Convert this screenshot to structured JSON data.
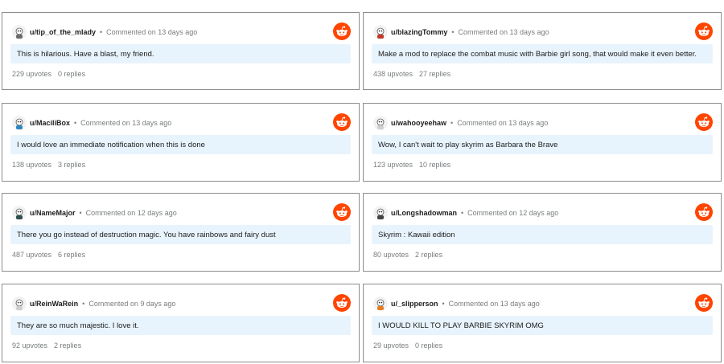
{
  "comments": [
    {
      "user": "u/tip_of_the_mlady",
      "meta": "Commented on 13 days ago",
      "text": "This is hilarious. Have a blast, my friend.",
      "upvotes": "229 upvotes",
      "replies": "0 replies",
      "avatar": "#6b6b6b"
    },
    {
      "user": "u/blazingTommy",
      "meta": "Commented on 13 days ago",
      "text": "Make a mod to replace the combat music with Barbie girl song, that would make it even better.",
      "upvotes": "438 upvotes",
      "replies": "27 replies",
      "avatar": "#c0392b"
    },
    {
      "user": "u/MaciliBox",
      "meta": "Commented on 13 days ago",
      "text": "I would love an immediate notification when this is done",
      "upvotes": "138 upvotes",
      "replies": "3 replies",
      "avatar": "#2e86c1"
    },
    {
      "user": "u/wahooyeehaw",
      "meta": "Commented on 13 days ago",
      "text": "Wow, I can't wait to play skyrim as Barbara the Brave",
      "upvotes": "123 upvotes",
      "replies": "10 replies",
      "avatar": "#d0d0d0"
    },
    {
      "user": "u/NameMajor",
      "meta": "Commented on 12 days ago",
      "text": "There you go instead of destruction magic. You have rainbows and fairy dust",
      "upvotes": "487 upvotes",
      "replies": "6 replies",
      "avatar": "#2f4f4f"
    },
    {
      "user": "u/Longshadowman",
      "meta": "Commented on 12 days ago",
      "text": "Skyrim : Kawaii edition",
      "upvotes": "80 upvotes",
      "replies": "2 replies",
      "avatar": "#444444"
    },
    {
      "user": "u/ReinWaRein",
      "meta": "Commented on 9 days ago",
      "text": "They are so much majestic. I love it.",
      "upvotes": "92 upvotes",
      "replies": "2 replies",
      "avatar": "#d0d0d0"
    },
    {
      "user": "u/_slipperson",
      "meta": "Commented on 13 days ago",
      "text": "I WOULD KILL TO PLAY BARBIE SKYRIM OMG",
      "upvotes": "29 upvotes",
      "replies": "0 replies",
      "avatar": "#e67e22"
    }
  ],
  "separator": "•",
  "icons": {
    "brand": "reddit-logo",
    "brand_color": "#ff4500"
  },
  "colors": {
    "comment_bg": "#e8f4fd",
    "border": "#8c8c8c",
    "muted": "#787c7e"
  }
}
